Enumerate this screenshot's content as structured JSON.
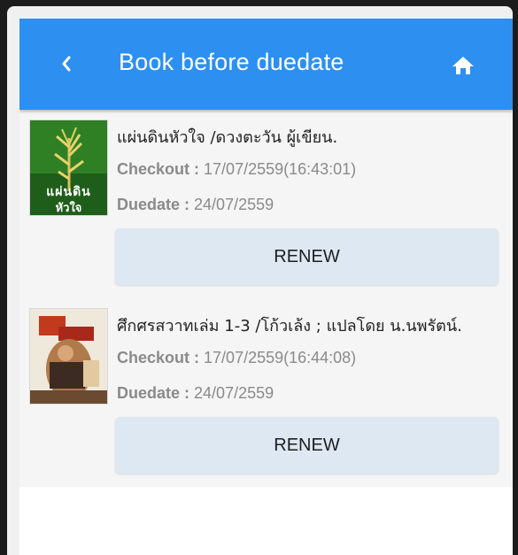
{
  "header": {
    "title": "Book before duedate",
    "back_icon": "chevron-left-icon",
    "home_icon": "home-icon"
  },
  "books": [
    {
      "title": "แผ่นดินหัวใจ /ดวงตะวัน ผู้เขียน.",
      "checkout_label": "Checkout :",
      "checkout_value": "17/07/2559(16:43:01)",
      "duedate_label": "Duedate :",
      "duedate_value": "24/07/2559",
      "cover_text_line1": "แผ่นดิน",
      "cover_text_line2": "หัวใจ",
      "renew_label": "RENEW"
    },
    {
      "title": "ศึกศรสวาทเล่ม 1-3 /โก้วเล้ง ; แปลโดย น.นพรัตน์.",
      "checkout_label": "Checkout :",
      "checkout_value": "17/07/2559(16:44:08)",
      "duedate_label": "Duedate :",
      "duedate_value": "24/07/2559",
      "renew_label": "RENEW"
    }
  ],
  "colors": {
    "header": "#2d8ff0",
    "renew_bg": "#dde8f2",
    "list_bg": "#f5f5f5"
  }
}
